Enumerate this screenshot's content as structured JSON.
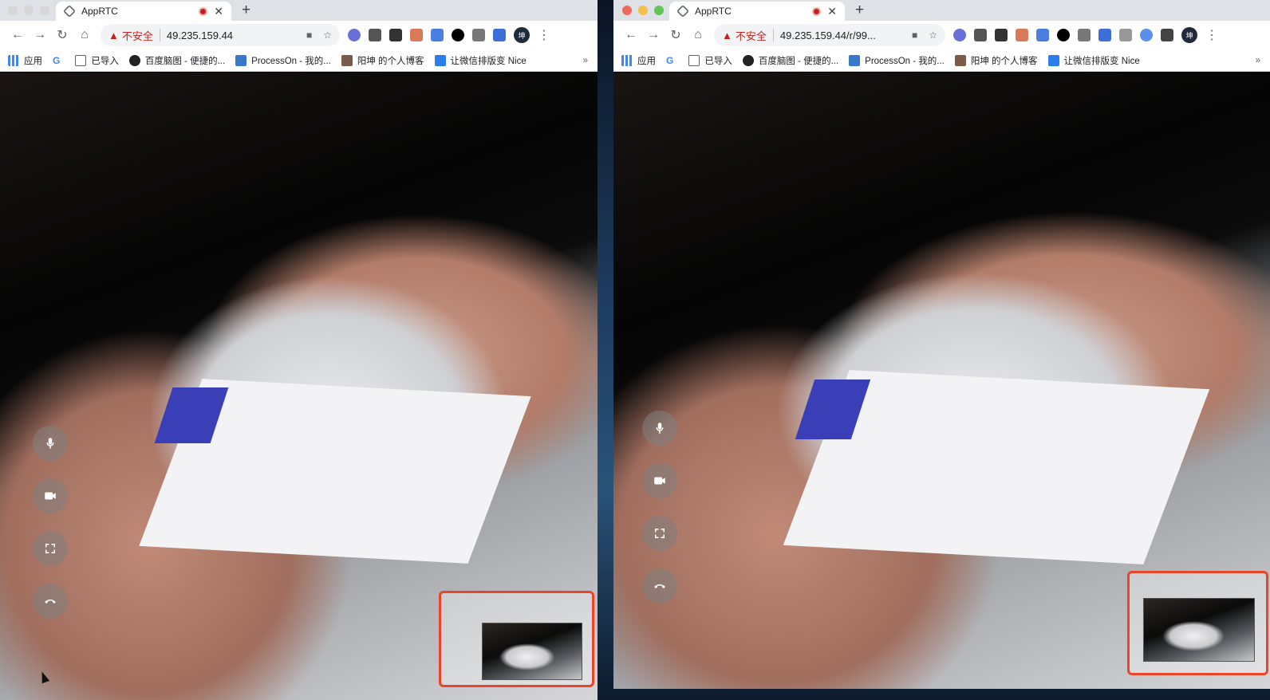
{
  "windows": [
    {
      "tab_title": "AppRTC",
      "security_label": "不安全",
      "url": "49.235.159.44",
      "bookmarks": [
        "应用",
        "已导入",
        "百度脑图 - 便捷的...",
        "ProcessOn - 我的...",
        "阳坤 的个人博客",
        "让微信排版变 Nice"
      ],
      "bookmarks_more": "»",
      "avatar": "坤"
    },
    {
      "tab_title": "AppRTC",
      "security_label": "不安全",
      "url": "49.235.159.44/r/99...",
      "bookmarks": [
        "应用",
        "已导入",
        "百度脑图 - 便捷的...",
        "ProcessOn - 我的...",
        "阳坤 的个人博客",
        "让微信排版变 Nice"
      ],
      "bookmarks_more": "»",
      "avatar": "坤"
    }
  ],
  "colors": {
    "highlight": "#e8452a",
    "insecure": "#c5221f"
  },
  "icons": [
    "mic-icon",
    "camera-icon",
    "fullscreen-icon",
    "hangup-icon"
  ]
}
